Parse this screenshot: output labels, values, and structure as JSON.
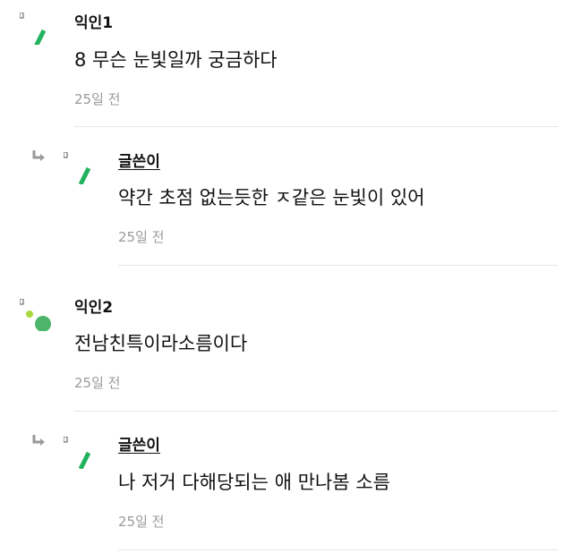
{
  "comments": [
    {
      "author": "익인1",
      "text": "8 무슨 눈빛일까 궁금하다",
      "time": "25일 전",
      "avatar_icon": "green-slash-avatar-icon",
      "is_reply": false
    },
    {
      "author": "글쓴이",
      "text": "약간 초점 없는듯한 ㅈ같은 눈빛이 있어",
      "time": "25일 전",
      "avatar_icon": "green-slash-avatar-icon",
      "is_reply": true
    },
    {
      "author": "익인2",
      "text": "전남친특이라소름이다",
      "time": "25일 전",
      "avatar_icon": "green-dots-avatar-icon",
      "is_reply": false
    },
    {
      "author": "글쓴이",
      "text": "나 저거 다해당되는 애 만나봄 소름",
      "time": "25일 전",
      "avatar_icon": "green-slash-avatar-icon",
      "is_reply": true
    }
  ],
  "colors": {
    "avatar_green": "#22b35e",
    "avatar_light_green": "#a8d93a",
    "avatar_mid_green": "#4cb56a",
    "time_gray": "#9a9a9a",
    "divider": "#e6e6e6",
    "reply_arrow": "#9a9a9a"
  }
}
